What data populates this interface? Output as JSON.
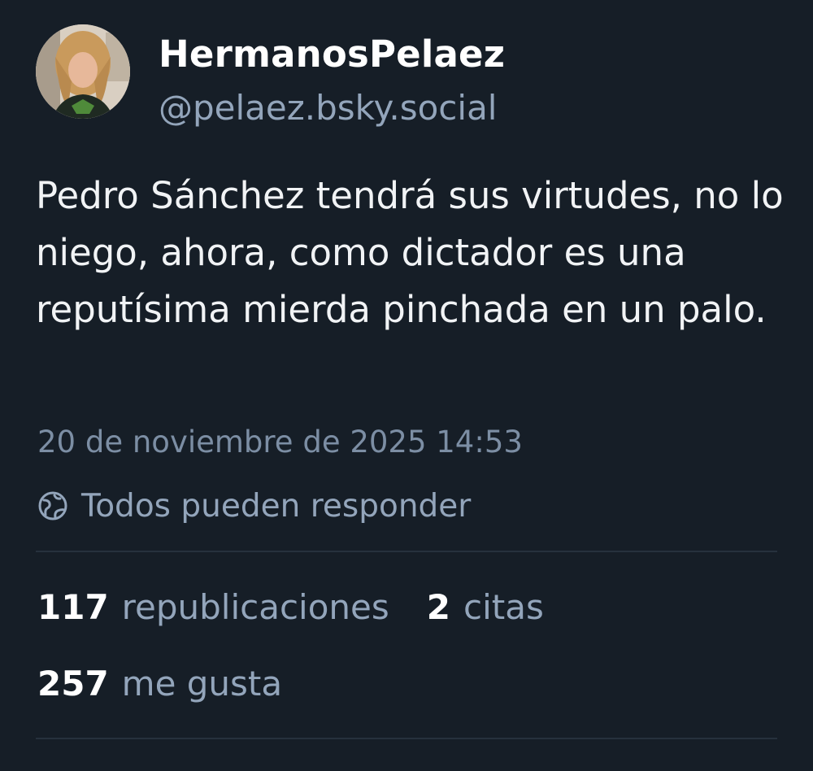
{
  "author": {
    "display_name": "HermanosPelaez",
    "handle": "@pelaez.bsky.social"
  },
  "post": {
    "text": "Pedro Sánchez tendrá sus virtudes, no lo niego, ahora, como dictador es una reputísima mierda pinchada en un palo.",
    "timestamp": "20 de noviembre de 2025 14:53",
    "reply_setting": "Todos pueden responder",
    "reply_icon": "globe-icon"
  },
  "stats": {
    "reposts": {
      "count": "117",
      "label": "republicaciones"
    },
    "quotes": {
      "count": "2",
      "label": "citas"
    },
    "likes": {
      "count": "257",
      "label": "me gusta"
    }
  },
  "colors": {
    "background": "#161e27",
    "text_primary": "#f1f3f5",
    "text_secondary": "#93a5bb",
    "divider": "#26313d"
  }
}
